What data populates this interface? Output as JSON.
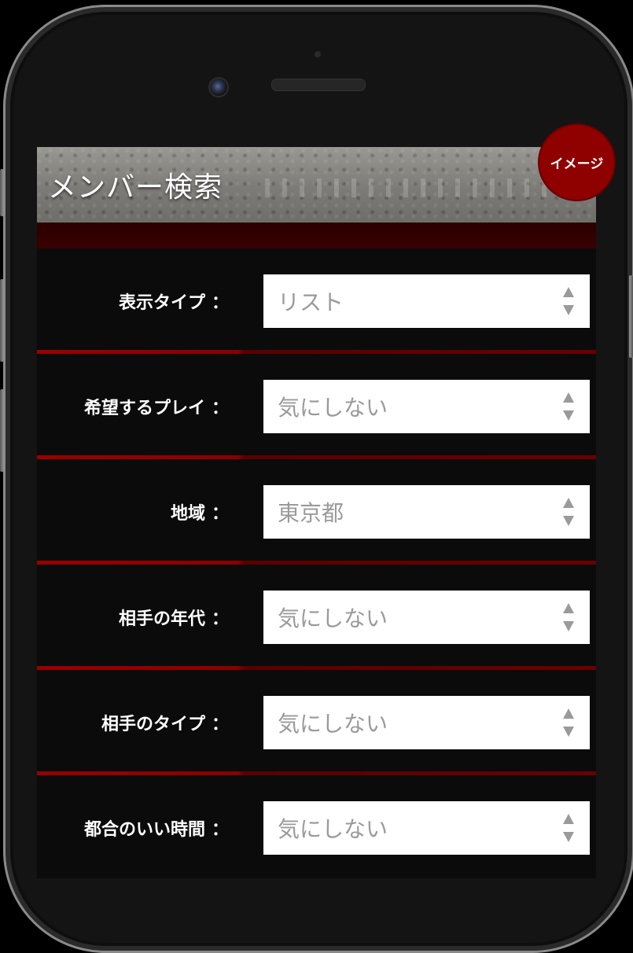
{
  "header": {
    "title": "メンバー検索"
  },
  "badge": {
    "label": "イメージ"
  },
  "form": {
    "colon": "：",
    "fields": [
      {
        "label": "表示タイプ",
        "value": "リスト"
      },
      {
        "label": "希望するプレイ",
        "value": "気にしない"
      },
      {
        "label": "地域",
        "value": "東京都"
      },
      {
        "label": "相手の年代",
        "value": "気にしない"
      },
      {
        "label": "相手のタイプ",
        "value": "気にしない"
      },
      {
        "label": "都合のいい時間",
        "value": "気にしない"
      }
    ]
  },
  "colors": {
    "accent": "#8f0000",
    "separator": "#9a0000",
    "background": "#0b0b0b",
    "field_bg": "#ffffff",
    "field_text": "#9a9a9a"
  }
}
